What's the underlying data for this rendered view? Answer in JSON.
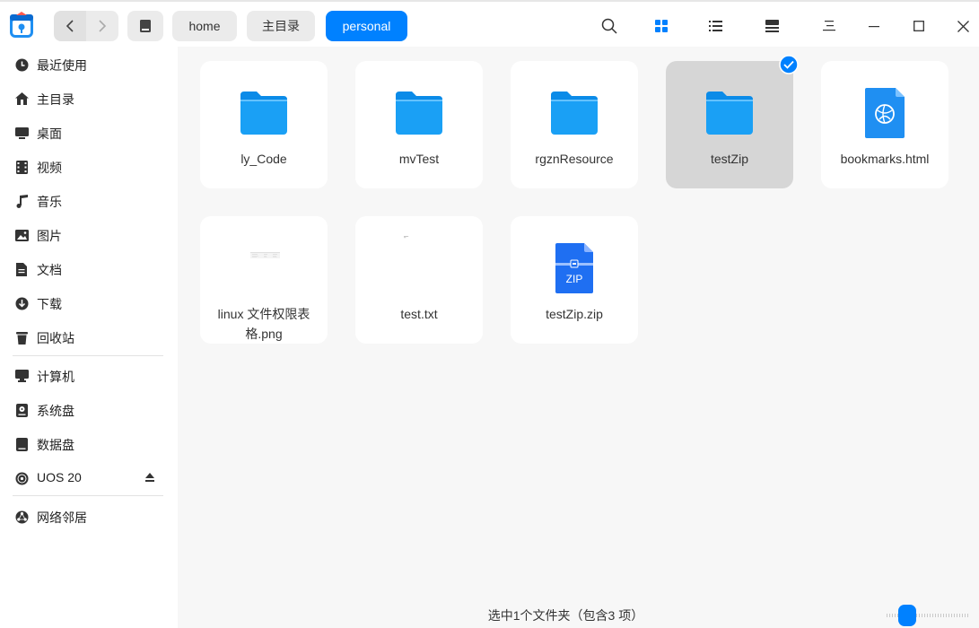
{
  "titlebar": {
    "breadcrumbs": [
      {
        "label": "home",
        "active": false
      },
      {
        "label": "主目录",
        "active": false
      },
      {
        "label": "personal",
        "active": true
      }
    ],
    "icons": [
      "search-icon",
      "grid-view-icon",
      "list-view-icon",
      "detail-view-icon",
      "menu-icon",
      "minimize-icon",
      "maximize-icon",
      "close-icon"
    ]
  },
  "sidebar": {
    "items": [
      {
        "label": "最近使用",
        "icon": "recent-icon"
      },
      {
        "label": "主目录",
        "icon": "home-icon"
      },
      {
        "label": "桌面",
        "icon": "desktop-icon"
      },
      {
        "label": "视频",
        "icon": "video-icon"
      },
      {
        "label": "音乐",
        "icon": "music-icon"
      },
      {
        "label": "图片",
        "icon": "picture-icon"
      },
      {
        "label": "文档",
        "icon": "document-icon"
      },
      {
        "label": "下载",
        "icon": "download-icon"
      },
      {
        "label": "回收站",
        "icon": "trash-icon"
      }
    ],
    "devices": [
      {
        "label": "计算机",
        "icon": "computer-icon"
      },
      {
        "label": "系统盘",
        "icon": "system-disk-icon"
      },
      {
        "label": "数据盘",
        "icon": "data-disk-icon"
      },
      {
        "label": "UOS 20",
        "icon": "disc-icon",
        "ejectable": true
      }
    ],
    "network": [
      {
        "label": "网络邻居",
        "icon": "network-icon"
      }
    ]
  },
  "files": [
    {
      "name": "ly_Code",
      "type": "folder",
      "selected": false
    },
    {
      "name": "mvTest",
      "type": "folder",
      "selected": false
    },
    {
      "name": "rgznResource",
      "type": "folder",
      "selected": false
    },
    {
      "name": "testZip",
      "type": "folder",
      "selected": true
    },
    {
      "name": "bookmarks.html",
      "type": "html",
      "selected": false
    },
    {
      "name": "linux 文件权限表格.png",
      "type": "image",
      "selected": false
    },
    {
      "name": "test.txt",
      "type": "text",
      "selected": false
    },
    {
      "name": "testZip.zip",
      "type": "zip",
      "selected": false,
      "badge": "ZIP"
    }
  ],
  "status": {
    "text": "选中1个文件夹（包含3 项）"
  },
  "colors": {
    "accent": "#0081ff",
    "folder": "#1aa0f5",
    "selected_tile": "#d6d6d6"
  }
}
